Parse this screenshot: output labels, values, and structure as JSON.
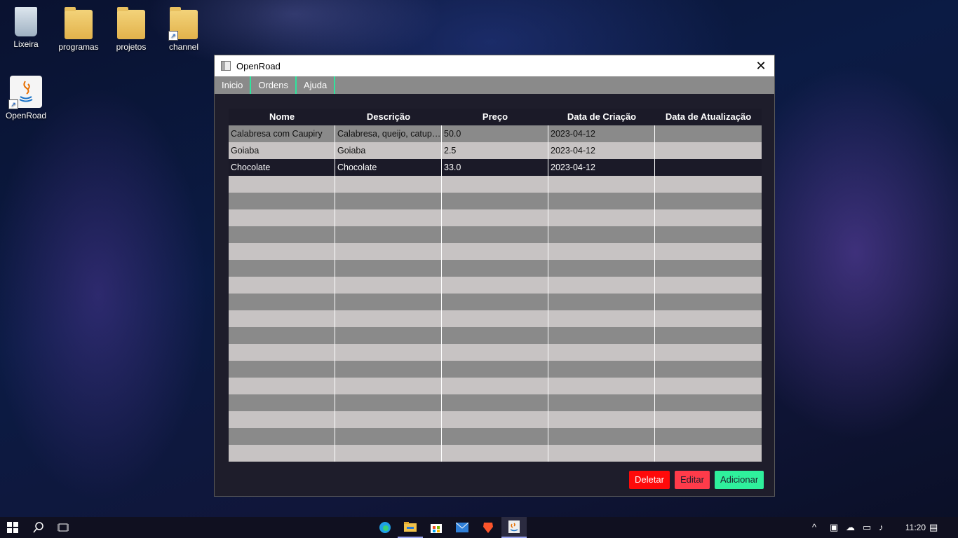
{
  "desktop": {
    "icons": [
      {
        "label": "Lixeira",
        "icon": "recycle-bin-icon"
      },
      {
        "label": "programas",
        "icon": "folder-icon"
      },
      {
        "label": "projetos",
        "icon": "folder-icon"
      },
      {
        "label": "channel",
        "icon": "folder-shortcut-icon"
      },
      {
        "label": "OpenRoad",
        "icon": "java-app-shortcut-icon"
      }
    ]
  },
  "window": {
    "title": "OpenRoad",
    "close_icon": "✕",
    "menu": [
      "Inicio",
      "Ordens",
      "Ajuda"
    ],
    "table": {
      "columns": [
        "Nome",
        "Descrição",
        "Preço",
        "Data de Criação",
        "Data de Atualização"
      ],
      "rows": [
        [
          "Calabresa com Caupiry",
          "Calabresa, queijo, catupir...",
          "50.0",
          "2023-04-12",
          ""
        ],
        [
          "Goiaba",
          "Goiaba",
          "2.5",
          "2023-04-12",
          ""
        ],
        [
          "Chocolate",
          "Chocolate",
          "33.0",
          "2023-04-12",
          ""
        ]
      ],
      "selected_row": 2,
      "empty_rows": 17
    },
    "buttons": {
      "delete": "Deletar",
      "edit": "Editar",
      "add": "Adicionar"
    },
    "colors": {
      "accent": "#2ee59d",
      "delete": "#ff0a0a",
      "edit": "#ff3b4a",
      "add": "#2ff09c",
      "background": "#1e1d2b"
    }
  },
  "taskbar": {
    "clock": "11:20",
    "icons": [
      "windows-start-icon",
      "search-icon",
      "task-view-icon",
      "edge-icon",
      "file-explorer-icon",
      "store-icon",
      "mail-icon",
      "brave-icon",
      "java-app-icon"
    ],
    "tray": [
      "chevron-up-icon",
      "meet-icon",
      "cloud-icon",
      "network-icon",
      "volume-icon",
      "notification-icon"
    ]
  }
}
